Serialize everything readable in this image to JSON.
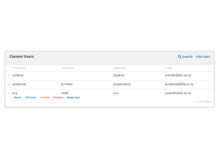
{
  "panel": {
    "title": "Current Users",
    "search_label": "Search",
    "add_user_label": "Add User"
  },
  "columns": [
    "First Name",
    "Last Name",
    "Username",
    "Email"
  ],
  "rows": [
    {
      "toggle": "+",
      "first": "rjsadmin",
      "last": "",
      "username": "rjsadmin",
      "email": "rhenderd@sfu.ac.za"
    },
    {
      "toggle": "+",
      "first": "ainsamonk",
      "last": "du Preez",
      "username": "ainsamonkop",
      "email": "ainsamonk@sfu.ac.za"
    },
    {
      "toggle": "−",
      "first": "Eva",
      "last": "Smith",
      "username": "eva",
      "email": "evasmith@sfu.ac.za"
    }
  ],
  "actions": {
    "email": "Email",
    "edit": "Edit User",
    "disable": "Disable",
    "remove": "Remove",
    "merge": "Merge User"
  },
  "pagination": {
    "prev": "‹",
    "summary": "1 - 3 of 3 items",
    "next": "›"
  },
  "colors": {
    "link": "#2a78c2",
    "disable": "#e07b2a",
    "remove": "#d64545",
    "header_bg": "#f1f1f1"
  }
}
